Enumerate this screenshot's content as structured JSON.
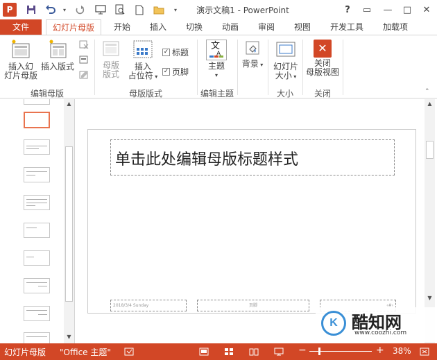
{
  "window": {
    "title": "演示文稿1 - PowerPoint",
    "app_logo": "P",
    "help": "?",
    "controls": {
      "ribbon_options": "▭",
      "minimize": "—",
      "maximize": "□",
      "close": "✕"
    }
  },
  "quick_access": [
    {
      "icon": "save-icon"
    },
    {
      "icon": "undo-icon"
    },
    {
      "icon": "redo-icon"
    },
    {
      "icon": "present-icon"
    },
    {
      "icon": "print-preview-icon"
    },
    {
      "icon": "new-icon"
    },
    {
      "icon": "open-icon"
    },
    {
      "icon": "customize-icon"
    }
  ],
  "tabs": {
    "file": "文件",
    "items": [
      "幻灯片母版",
      "开始",
      "插入",
      "切换",
      "动画",
      "审阅",
      "视图",
      "开发工具",
      "加载项"
    ],
    "active_index": 0
  },
  "ribbon": {
    "edit_master": {
      "insert_slide_master": "插入幻灯片母版",
      "insert_slide_master_l1": "插入幻",
      "insert_slide_master_l2": "灯片母版",
      "insert_layout": "插入版式",
      "label": "编辑母版"
    },
    "master_layout": {
      "master_layout_btn_l1": "母版",
      "master_layout_btn_l2": "版式",
      "insert_placeholder_l1": "插入",
      "insert_placeholder_l2": "占位符",
      "title_check": "标题",
      "footer_check": "页脚",
      "label": "母版版式"
    },
    "edit_theme": {
      "themes": "主题",
      "label": "编辑主题",
      "theme_icon_text": "文",
      "theme_icon_sub": "A"
    },
    "background": {
      "background": "背景"
    },
    "size": {
      "slide_size_l1": "幻灯片",
      "slide_size_l2": "大小",
      "label": "大小"
    },
    "close": {
      "close_l1": "关闭",
      "close_l2": "母版视图",
      "label": "关闭"
    }
  },
  "slide": {
    "title_placeholder": "单击此处编辑母版标题样式",
    "date_placeholder": "2018/3/4 Sunday",
    "footer_placeholder": "页脚",
    "number_placeholder": "‹#›"
  },
  "watermark": {
    "logo": "K",
    "name": "酷知网",
    "url": "www.coozhi.com"
  },
  "status": {
    "view_label": "幻灯片母版",
    "theme_label": "\"Office 主题\"",
    "zoom_minus": "−",
    "zoom_plus": "+",
    "zoom_percent": "38%",
    "zoom_level": 0.38
  },
  "colors": {
    "accent": "#d24726",
    "selected_thumb": "#e9744f"
  }
}
